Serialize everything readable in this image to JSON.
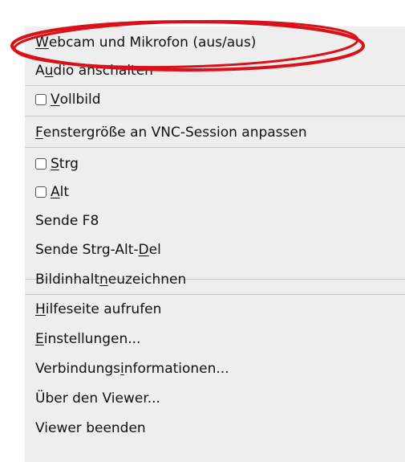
{
  "menu": {
    "items": [
      {
        "pre": "",
        "mn": "W",
        "post": "ebcam und Mikrofon (aus/aus)"
      },
      {
        "pre": "A",
        "mn": "u",
        "post": "dio anschalten"
      },
      {
        "pre": "",
        "mn": "V",
        "post": "ollbild"
      },
      {
        "pre": "",
        "mn": "F",
        "post": "enstergröße an VNC-Session anpassen"
      },
      {
        "pre": "",
        "mn": "S",
        "post": "trg"
      },
      {
        "pre": "",
        "mn": "A",
        "post": "lt"
      },
      {
        "pre": "Sende F8",
        "mn": "",
        "post": ""
      },
      {
        "pre": "Sende Strg-Alt-",
        "mn": "D",
        "post": "el"
      },
      {
        "pre": "Bildinhalt ",
        "mn": "n",
        "post": "euzeichnen"
      },
      {
        "pre": "",
        "mn": "H",
        "post": "ilfeseite aufrufen"
      },
      {
        "pre": "",
        "mn": "E",
        "post": "instellungen..."
      },
      {
        "pre": "Verbindungs",
        "mn": "i",
        "post": "nformationen..."
      },
      {
        "pre": "Über den Viewer...",
        "mn": "",
        "post": ""
      },
      {
        "pre": "Viewer beenden",
        "mn": "",
        "post": ""
      }
    ]
  },
  "annotation": {
    "ring_color": "#d9111a"
  }
}
